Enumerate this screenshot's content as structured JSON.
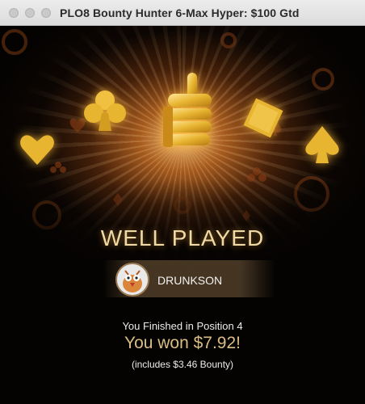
{
  "window": {
    "title": "PLO8 Bounty Hunter 6-Max Hyper: $100 Gtd"
  },
  "result": {
    "heading": "WELL PLAYED",
    "player_name": "DRUNKSON",
    "finish_text": "You Finished in Position 4",
    "won_text": "You won $7.92!",
    "bounty_text": "(includes $3.46 Bounty)"
  },
  "colors": {
    "gold": "#e8b530",
    "heading": "#f1d9a4",
    "won_amount": "#d9bd84"
  },
  "icons": [
    "thumbs-up-icon",
    "club-icon",
    "diamond-icon",
    "heart-icon",
    "spade-icon",
    "poker-chip-icon",
    "avatar-bird-icon"
  ]
}
